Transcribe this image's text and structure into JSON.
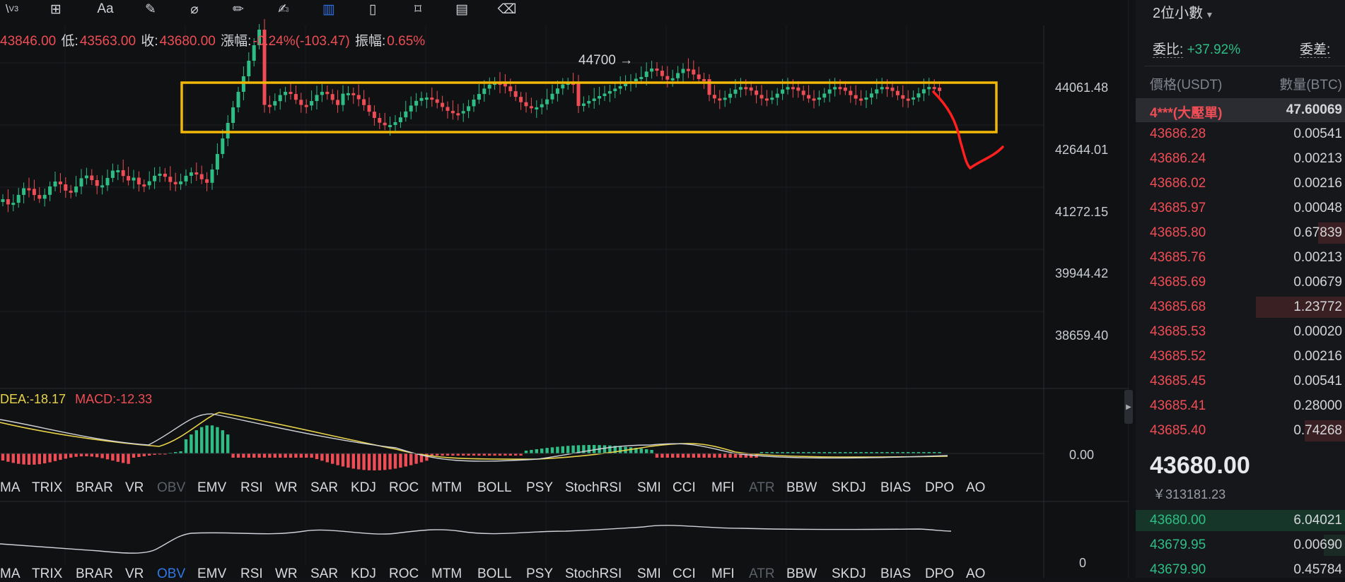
{
  "toolbar": {
    "icons": [
      "line-tool-icon",
      "add-indicator-icon",
      "text-tool-icon",
      "ruler-icon",
      "measure-icon",
      "pencil-icon",
      "brush-icon",
      "candle-type-icon",
      "delete-icon",
      "bookmark-icon",
      "note-icon",
      "trash-icon"
    ],
    "v3_label": "V3",
    "text_tool_label": "Aa"
  },
  "ohlc": {
    "high_value": "43846.00",
    "low_label": "低:",
    "low_value": "43563.00",
    "close_label": "收:",
    "close_value": "43680.00",
    "change_label": "漲幅:",
    "change_value": "-0.24%(-103.47)",
    "amplitude_label": "振幅:",
    "amplitude_value": "0.65%"
  },
  "annotation_label": "44700 →",
  "price_axis": [
    "44061.48",
    "42644.01",
    "41272.15",
    "39944.42",
    "38659.40"
  ],
  "macd": {
    "dea_label": "DEA:",
    "dea_value": "-18.17",
    "macd_label": "MACD:",
    "macd_value": "-12.33",
    "zero_label": "0.00"
  },
  "obv_zero_label": "0",
  "indicator_tabs": [
    {
      "label": "MA",
      "state": "normal"
    },
    {
      "label": "TRIX",
      "state": "normal"
    },
    {
      "label": "BRAR",
      "state": "normal"
    },
    {
      "label": "VR",
      "state": "normal"
    },
    {
      "label": "OBV",
      "state": "dim"
    },
    {
      "label": "EMV",
      "state": "normal"
    },
    {
      "label": "RSI",
      "state": "normal"
    },
    {
      "label": "WR",
      "state": "normal"
    },
    {
      "label": "SAR",
      "state": "normal"
    },
    {
      "label": "KDJ",
      "state": "normal"
    },
    {
      "label": "ROC",
      "state": "normal"
    },
    {
      "label": "MTM",
      "state": "normal"
    },
    {
      "label": "BOLL",
      "state": "normal"
    },
    {
      "label": "PSY",
      "state": "normal"
    },
    {
      "label": "StochRSI",
      "state": "normal"
    },
    {
      "label": "SMI",
      "state": "normal"
    },
    {
      "label": "CCI",
      "state": "normal"
    },
    {
      "label": "MFI",
      "state": "normal"
    },
    {
      "label": "ATR",
      "state": "dim"
    },
    {
      "label": "BBW",
      "state": "normal"
    },
    {
      "label": "SKDJ",
      "state": "normal"
    },
    {
      "label": "BIAS",
      "state": "normal"
    },
    {
      "label": "DPO",
      "state": "normal"
    },
    {
      "label": "AO",
      "state": "normal"
    }
  ],
  "indicator_tabs_lower_highlight": "OBV",
  "orderbook": {
    "precision_label": "2位小數",
    "bid_ratio_label": "委比:",
    "bid_ratio_value": "+37.92%",
    "diff_label": "委差:",
    "price_header": "價格(USDT)",
    "qty_header": "數量(BTC)",
    "big_order_label": "4***(大壓單)",
    "big_order_qty": "47.60069",
    "asks": [
      {
        "price": "43686.28",
        "qty": "0.00541",
        "depth": 0.0
      },
      {
        "price": "43686.24",
        "qty": "0.00213",
        "depth": 0.0
      },
      {
        "price": "43686.02",
        "qty": "0.00216",
        "depth": 0.0
      },
      {
        "price": "43685.97",
        "qty": "0.00048",
        "depth": 0.0
      },
      {
        "price": "43685.80",
        "qty": "0.67839",
        "depth": 0.3
      },
      {
        "price": "43685.76",
        "qty": "0.00213",
        "depth": 0.0
      },
      {
        "price": "43685.69",
        "qty": "0.00679",
        "depth": 0.0
      },
      {
        "price": "43685.68",
        "qty": "1.23772",
        "depth": 1.0
      },
      {
        "price": "43685.53",
        "qty": "0.00020",
        "depth": 0.0
      },
      {
        "price": "43685.52",
        "qty": "0.00216",
        "depth": 0.0
      },
      {
        "price": "43685.45",
        "qty": "0.00541",
        "depth": 0.0
      },
      {
        "price": "43685.41",
        "qty": "0.28000",
        "depth": 0.0
      },
      {
        "price": "43685.40",
        "qty": "0.74268",
        "depth": 0.45
      }
    ],
    "last_price": "43680.00",
    "last_price_cny": "￥313181.23",
    "bids": [
      {
        "price": "43680.00",
        "qty": "6.04021",
        "depth": 1.0
      },
      {
        "price": "43679.95",
        "qty": "0.00690",
        "depth": 0.1
      },
      {
        "price": "43679.90",
        "qty": "0.45784",
        "depth": 0.0
      }
    ]
  },
  "colors": {
    "up": "#2ebd85",
    "down": "#ef4d55",
    "box": "#f2b705",
    "accent": "#2f6fe0"
  }
}
